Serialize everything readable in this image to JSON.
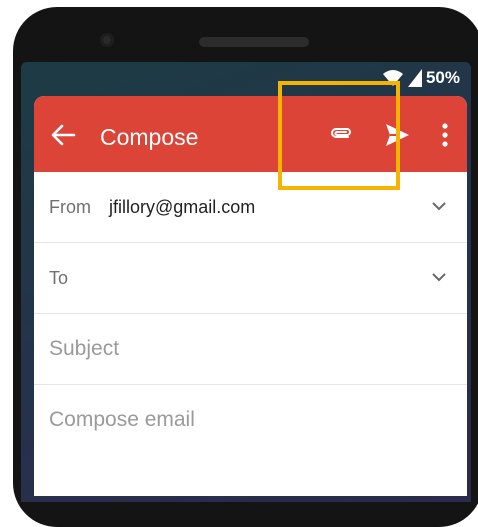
{
  "status_bar": {
    "battery": "50%"
  },
  "compose": {
    "title": "Compose",
    "from_label": "From",
    "from_value": "jfillory@gmail.com",
    "to_label": "To",
    "subject_placeholder": "Subject",
    "body_placeholder": "Compose email"
  },
  "colors": {
    "appbar": "#db4437",
    "highlight": "#f5b400"
  },
  "icons": [
    "back-arrow-icon",
    "attachment-icon",
    "send-icon",
    "more-vert-icon",
    "chevron-down-icon",
    "wifi-icon",
    "signal-icon"
  ]
}
